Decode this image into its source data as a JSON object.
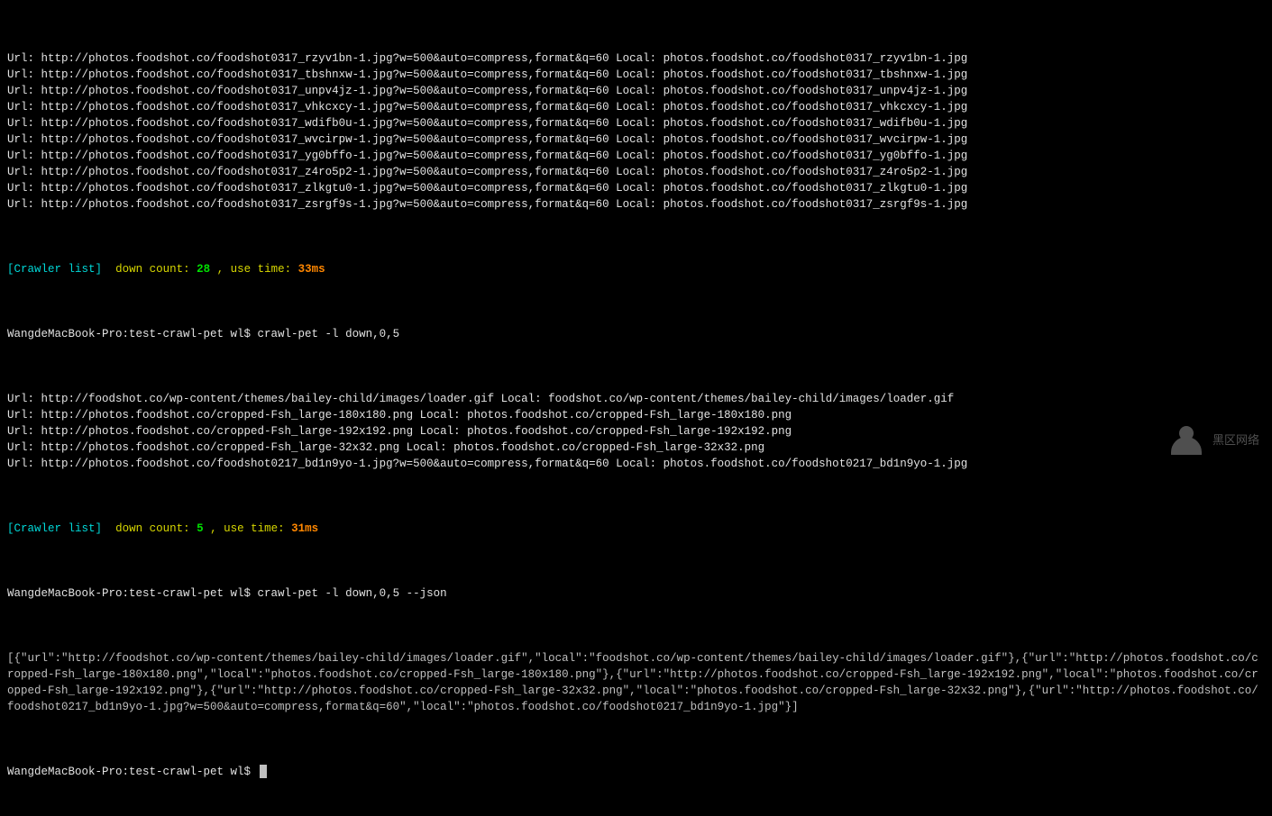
{
  "url_prefix": "Url: ",
  "local_prefix": "Local: ",
  "url_lines_1": [
    {
      "url": "http://photos.foodshot.co/foodshot0317_rzyv1bn-1.jpg?w=500&auto=compress,format&q=60",
      "local": "photos.foodshot.co/foodshot0317_rzyv1bn-1.jpg"
    },
    {
      "url": "http://photos.foodshot.co/foodshot0317_tbshnxw-1.jpg?w=500&auto=compress,format&q=60",
      "local": "photos.foodshot.co/foodshot0317_tbshnxw-1.jpg"
    },
    {
      "url": "http://photos.foodshot.co/foodshot0317_unpv4jz-1.jpg?w=500&auto=compress,format&q=60",
      "local": "photos.foodshot.co/foodshot0317_unpv4jz-1.jpg"
    },
    {
      "url": "http://photos.foodshot.co/foodshot0317_vhkcxcy-1.jpg?w=500&auto=compress,format&q=60",
      "local": "photos.foodshot.co/foodshot0317_vhkcxcy-1.jpg"
    },
    {
      "url": "http://photos.foodshot.co/foodshot0317_wdifb0u-1.jpg?w=500&auto=compress,format&q=60",
      "local": "photos.foodshot.co/foodshot0317_wdifb0u-1.jpg"
    },
    {
      "url": "http://photos.foodshot.co/foodshot0317_wvcirpw-1.jpg?w=500&auto=compress,format&q=60",
      "local": "photos.foodshot.co/foodshot0317_wvcirpw-1.jpg"
    },
    {
      "url": "http://photos.foodshot.co/foodshot0317_yg0bffo-1.jpg?w=500&auto=compress,format&q=60",
      "local": "photos.foodshot.co/foodshot0317_yg0bffo-1.jpg"
    },
    {
      "url": "http://photos.foodshot.co/foodshot0317_z4ro5p2-1.jpg?w=500&auto=compress,format&q=60",
      "local": "photos.foodshot.co/foodshot0317_z4ro5p2-1.jpg"
    },
    {
      "url": "http://photos.foodshot.co/foodshot0317_zlkgtu0-1.jpg?w=500&auto=compress,format&q=60",
      "local": "photos.foodshot.co/foodshot0317_zlkgtu0-1.jpg"
    },
    {
      "url": "http://photos.foodshot.co/foodshot0317_zsrgf9s-1.jpg?w=500&auto=compress,format&q=60",
      "local": "photos.foodshot.co/foodshot0317_zsrgf9s-1.jpg"
    }
  ],
  "status_1": {
    "label_open": "[",
    "label_text": "Crawler list",
    "label_close": "]",
    "down_count_label": "down count: ",
    "down_count_value": "28",
    "sep": " , ",
    "use_time_label": "use time: ",
    "use_time_value": "33ms"
  },
  "prompt": "WangdeMacBook-Pro:test-crawl-pet wl$ ",
  "cmd_1": "crawl-pet -l down,0,5",
  "url_lines_2": [
    {
      "url": "http://foodshot.co/wp-content/themes/bailey-child/images/loader.gif",
      "local": "foodshot.co/wp-content/themes/bailey-child/images/loader.gif"
    },
    {
      "url": "http://photos.foodshot.co/cropped-Fsh_large-180x180.png",
      "local": "photos.foodshot.co/cropped-Fsh_large-180x180.png"
    },
    {
      "url": "http://photos.foodshot.co/cropped-Fsh_large-192x192.png",
      "local": "photos.foodshot.co/cropped-Fsh_large-192x192.png"
    },
    {
      "url": "http://photos.foodshot.co/cropped-Fsh_large-32x32.png",
      "local": "photos.foodshot.co/cropped-Fsh_large-32x32.png"
    },
    {
      "url": "http://photos.foodshot.co/foodshot0217_bd1n9yo-1.jpg?w=500&auto=compress,format&q=60",
      "local": "photos.foodshot.co/foodshot0217_bd1n9yo-1.jpg"
    }
  ],
  "status_2": {
    "label_open": "[",
    "label_text": "Crawler list",
    "label_close": "]",
    "down_count_label": "down count: ",
    "down_count_value": "5",
    "sep": " , ",
    "use_time_label": "use time: ",
    "use_time_value": "31ms"
  },
  "cmd_2": "crawl-pet -l down,0,5 --json",
  "json_output": "[{\"url\":\"http://foodshot.co/wp-content/themes/bailey-child/images/loader.gif\",\"local\":\"foodshot.co/wp-content/themes/bailey-child/images/loader.gif\"},{\"url\":\"http://photos.foodshot.co/cropped-Fsh_large-180x180.png\",\"local\":\"photos.foodshot.co/cropped-Fsh_large-180x180.png\"},{\"url\":\"http://photos.foodshot.co/cropped-Fsh_large-192x192.png\",\"local\":\"photos.foodshot.co/cropped-Fsh_large-192x192.png\"},{\"url\":\"http://photos.foodshot.co/cropped-Fsh_large-32x32.png\",\"local\":\"photos.foodshot.co/cropped-Fsh_large-32x32.png\"},{\"url\":\"http://photos.foodshot.co/foodshot0217_bd1n9yo-1.jpg?w=500&auto=compress,format&q=60\",\"local\":\"photos.foodshot.co/foodshot0217_bd1n9yo-1.jpg\"}]",
  "watermark": "黑区网络"
}
